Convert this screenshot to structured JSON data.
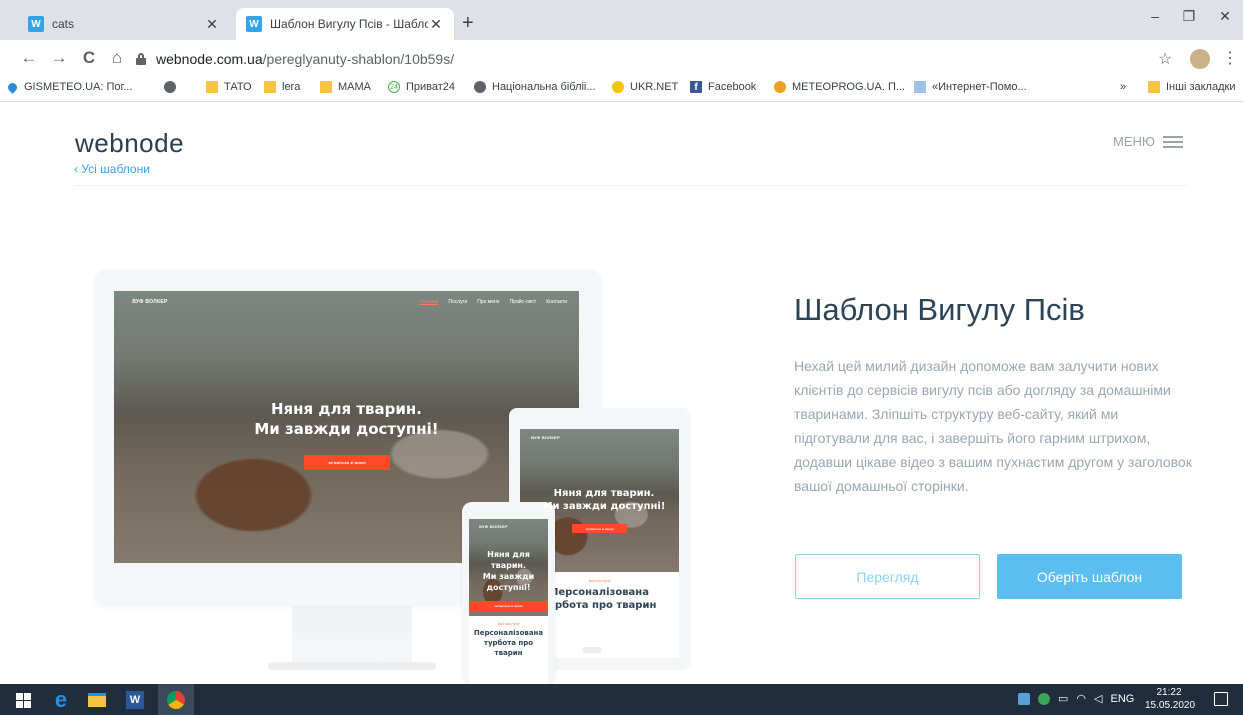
{
  "browser": {
    "tabs": [
      {
        "title": "cats",
        "favicon": "W"
      },
      {
        "title": "Шаблон Вигулу Псів - Шаблон",
        "favicon": "W"
      }
    ],
    "new_tab": "+",
    "url_host": "webnode.com.ua",
    "url_path": "/pereglyanuty-shablon/10b59s/",
    "window_controls": {
      "minimize": "–",
      "restore": "❐",
      "close": "✕"
    },
    "nav": {
      "back": "←",
      "forward": "→",
      "reload": "C",
      "home": "⌂"
    },
    "star": "☆",
    "menu_dots": "⋮"
  },
  "bookmarks": {
    "items": [
      {
        "label": "GISMETEO.UA: Пог...",
        "icon": "drop-icon"
      },
      {
        "label": "",
        "icon": "globe-icon"
      },
      {
        "label": "ТАТО",
        "icon": "folder-icon"
      },
      {
        "label": "lera",
        "icon": "folder-icon"
      },
      {
        "label": "МАМА",
        "icon": "folder-icon"
      },
      {
        "label": "Приват24",
        "icon": "privat24-icon"
      },
      {
        "label": "Національна бібліі...",
        "icon": "globe-icon"
      },
      {
        "label": "UKR.NET",
        "icon": "ukrnet-icon"
      },
      {
        "label": "Facebook",
        "icon": "facebook-icon"
      },
      {
        "label": "METEOPROG.UA. П...",
        "icon": "meteoprog-icon"
      },
      {
        "label": "«Интернет-Помо...",
        "icon": "document-icon"
      }
    ],
    "overflow": "»",
    "other_folder": "Інші закладки",
    "privat_badge": "24"
  },
  "page": {
    "logo": "webnode",
    "back_link": "‹ Усі шаблони",
    "menu_label": "МЕНЮ",
    "title": "Шаблон Вигулу Псів",
    "description": "Нехай цей милий дизайн допоможе вам залучити нових клієнтів до сервісів вигулу псів або догляду за домашніми тваринами. Зліпшіть структуру веб-сайту, який ми підготували для вас, і завершіть його гарним штрихом, додавши цікаве відео з вашим пухнастим другом у заголовок вашої домашньої сторінки.",
    "preview_button": "Перегляд",
    "choose_button": "Оберіть шаблон"
  },
  "mockup": {
    "brand": "ВУФ ВОЛКЕР",
    "nav_links": [
      "Головна",
      "Послуги",
      "Про мене",
      "Прайс-лист",
      "Контакти"
    ],
    "headline_line1": "Няня для тварин.",
    "headline_line2": "Ми завжди доступні!",
    "cta": "звʼяжіться зі мною",
    "section_kicker": "мої послуги",
    "section_title": "Персоналізована турбота про тварин"
  },
  "taskbar": {
    "time": "21:22",
    "date": "15.05.2020",
    "language": "ENG"
  },
  "colors": {
    "accent": "#5cbdf0",
    "accent_light": "#8fd0f4",
    "title": "#2d4356",
    "body_text": "#9ba6b0",
    "mockup_cta": "#ff4a2a",
    "taskbar": "#1f2d3d"
  }
}
